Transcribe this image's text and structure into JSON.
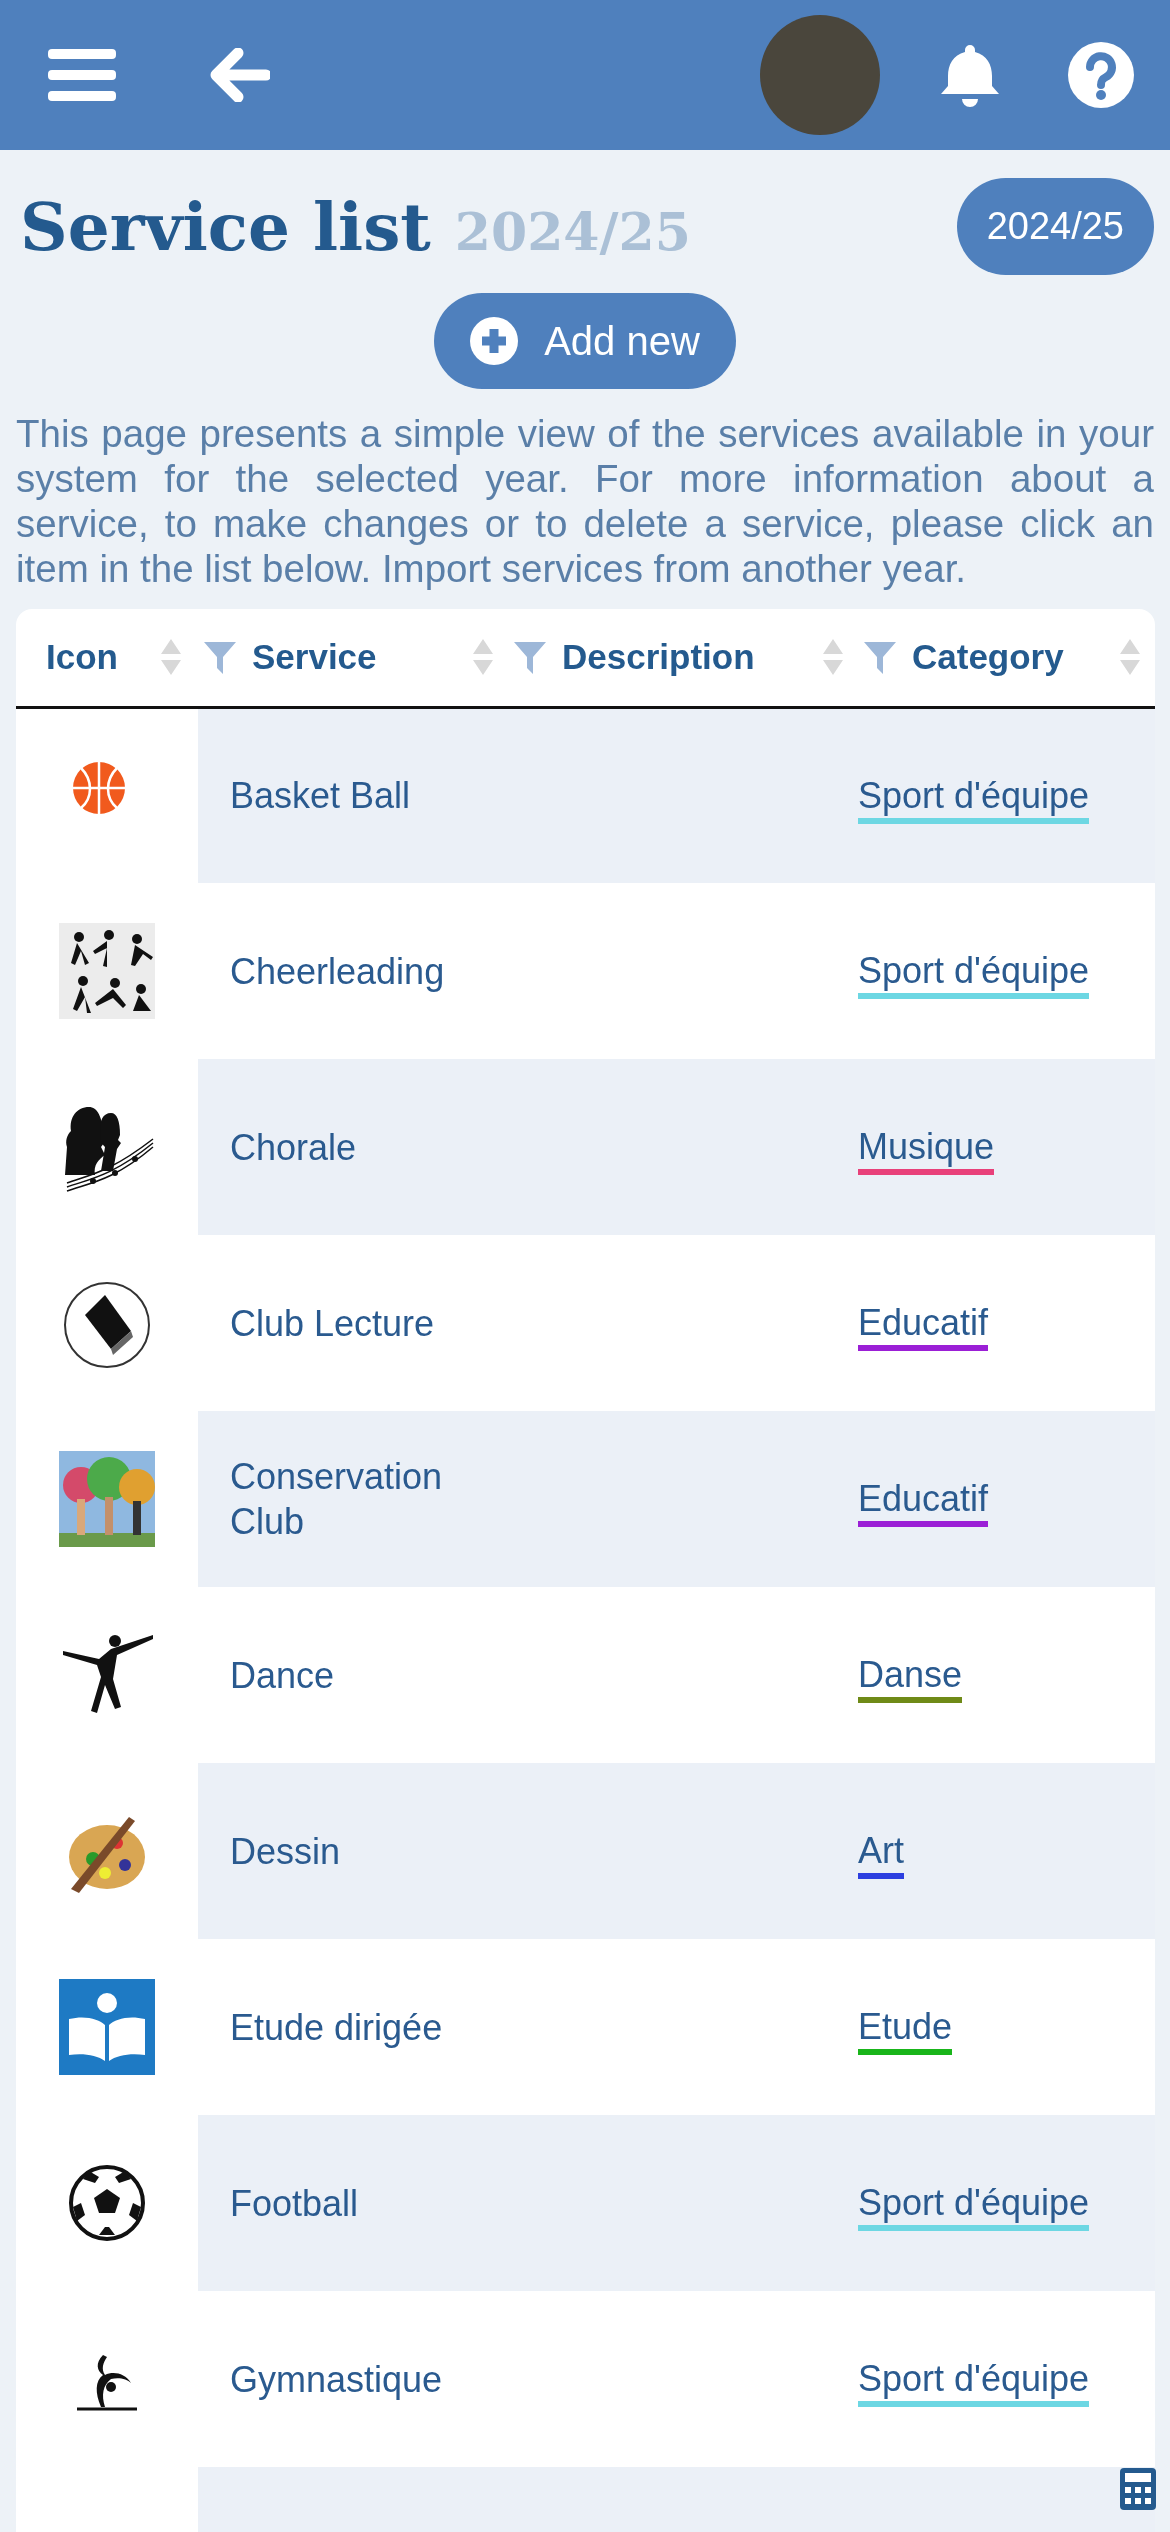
{
  "page": {
    "title": "Service list",
    "year": "2024/25",
    "year_button": "2024/25",
    "add_button": "Add new",
    "intro": "This page presents a simple view of the services available in your system for the selected year. For more information about a service, to make changes or to delete a service, please click an item in the list below. Import services from another year."
  },
  "table": {
    "columns": [
      {
        "label": "Icon",
        "filterable": false
      },
      {
        "label": "Service",
        "filterable": true
      },
      {
        "label": "Description",
        "filterable": true
      },
      {
        "label": "Category",
        "filterable": true
      }
    ],
    "rows": [
      {
        "service": "Basket Ball",
        "category": "Sport d'équipe",
        "color": "#6dd7e3"
      },
      {
        "service": "Cheerleading",
        "category": "Sport d'équipe",
        "color": "#6dd7e3"
      },
      {
        "service": "Chorale",
        "category": "Musique",
        "color": "#e8407a"
      },
      {
        "service": "Club Lecture",
        "category": "Educatif",
        "color": "#9b1fd6"
      },
      {
        "service": "Conservation Club",
        "category": "Educatif",
        "color": "#9b1fd6"
      },
      {
        "service": "Dance",
        "category": "Danse",
        "color": "#6f8a17"
      },
      {
        "service": "Dessin",
        "category": "Art",
        "color": "#2d3fe0"
      },
      {
        "service": "Etude dirigée",
        "category": "Etude",
        "color": "#19b51a"
      },
      {
        "service": "Football",
        "category": "Sport d'équipe",
        "color": "#6dd7e3"
      },
      {
        "service": "Gymnastique",
        "category": "Sport d'équipe",
        "color": "#6dd7e3"
      }
    ]
  }
}
